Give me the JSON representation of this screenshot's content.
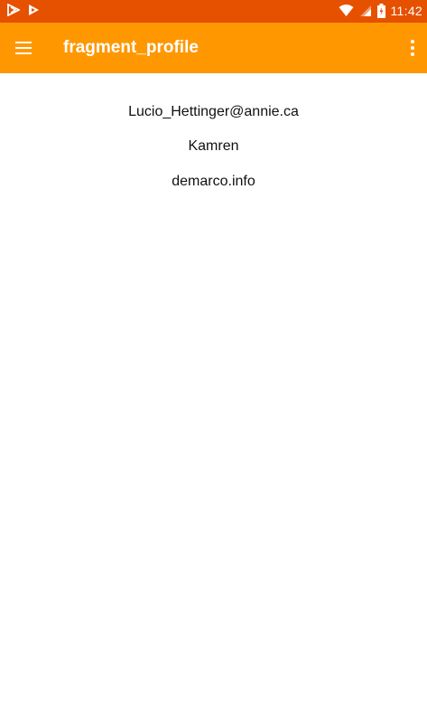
{
  "status_bar": {
    "time": "11:42",
    "left_icons": [
      "notification-arrow-icon",
      "play-store-icon"
    ],
    "right_icons": [
      "wifi-icon",
      "cell-signal-icon",
      "battery-charging-icon"
    ],
    "background_color": "#e65100"
  },
  "toolbar": {
    "title": "fragment_profile",
    "menu_icon": "hamburger-menu-icon",
    "overflow_icon": "more-vertical-icon",
    "background_color": "#ff9800"
  },
  "profile": {
    "email": "Lucio_Hettinger@annie.ca",
    "name": "Kamren",
    "website": "demarco.info"
  }
}
